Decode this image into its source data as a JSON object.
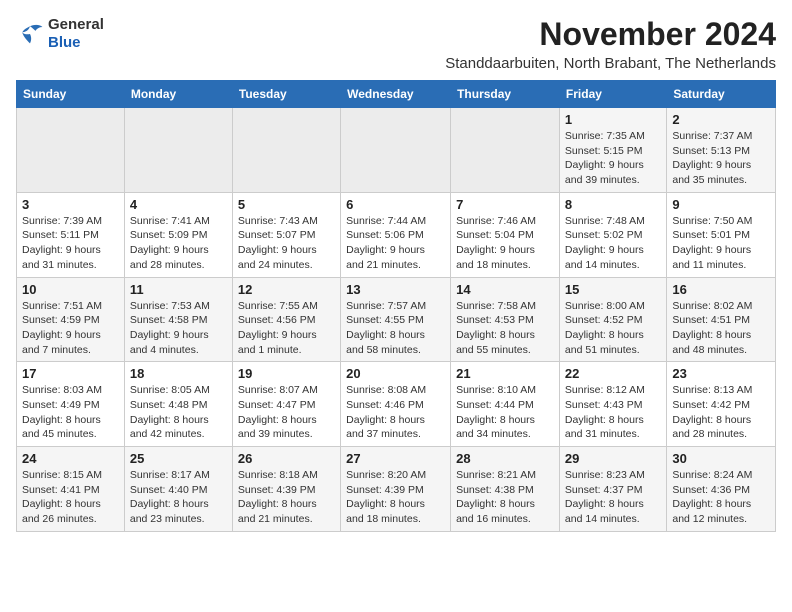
{
  "logo": {
    "text_general": "General",
    "text_blue": "Blue",
    "tagline": ""
  },
  "header": {
    "title": "November 2024",
    "subtitle": "Standdaarbuiten, North Brabant, The Netherlands"
  },
  "columns": [
    "Sunday",
    "Monday",
    "Tuesday",
    "Wednesday",
    "Thursday",
    "Friday",
    "Saturday"
  ],
  "weeks": [
    {
      "days": [
        {
          "num": "",
          "detail": ""
        },
        {
          "num": "",
          "detail": ""
        },
        {
          "num": "",
          "detail": ""
        },
        {
          "num": "",
          "detail": ""
        },
        {
          "num": "",
          "detail": ""
        },
        {
          "num": "1",
          "detail": "Sunrise: 7:35 AM\nSunset: 5:15 PM\nDaylight: 9 hours and 39 minutes."
        },
        {
          "num": "2",
          "detail": "Sunrise: 7:37 AM\nSunset: 5:13 PM\nDaylight: 9 hours and 35 minutes."
        }
      ]
    },
    {
      "days": [
        {
          "num": "3",
          "detail": "Sunrise: 7:39 AM\nSunset: 5:11 PM\nDaylight: 9 hours and 31 minutes."
        },
        {
          "num": "4",
          "detail": "Sunrise: 7:41 AM\nSunset: 5:09 PM\nDaylight: 9 hours and 28 minutes."
        },
        {
          "num": "5",
          "detail": "Sunrise: 7:43 AM\nSunset: 5:07 PM\nDaylight: 9 hours and 24 minutes."
        },
        {
          "num": "6",
          "detail": "Sunrise: 7:44 AM\nSunset: 5:06 PM\nDaylight: 9 hours and 21 minutes."
        },
        {
          "num": "7",
          "detail": "Sunrise: 7:46 AM\nSunset: 5:04 PM\nDaylight: 9 hours and 18 minutes."
        },
        {
          "num": "8",
          "detail": "Sunrise: 7:48 AM\nSunset: 5:02 PM\nDaylight: 9 hours and 14 minutes."
        },
        {
          "num": "9",
          "detail": "Sunrise: 7:50 AM\nSunset: 5:01 PM\nDaylight: 9 hours and 11 minutes."
        }
      ]
    },
    {
      "days": [
        {
          "num": "10",
          "detail": "Sunrise: 7:51 AM\nSunset: 4:59 PM\nDaylight: 9 hours and 7 minutes."
        },
        {
          "num": "11",
          "detail": "Sunrise: 7:53 AM\nSunset: 4:58 PM\nDaylight: 9 hours and 4 minutes."
        },
        {
          "num": "12",
          "detail": "Sunrise: 7:55 AM\nSunset: 4:56 PM\nDaylight: 9 hours and 1 minute."
        },
        {
          "num": "13",
          "detail": "Sunrise: 7:57 AM\nSunset: 4:55 PM\nDaylight: 8 hours and 58 minutes."
        },
        {
          "num": "14",
          "detail": "Sunrise: 7:58 AM\nSunset: 4:53 PM\nDaylight: 8 hours and 55 minutes."
        },
        {
          "num": "15",
          "detail": "Sunrise: 8:00 AM\nSunset: 4:52 PM\nDaylight: 8 hours and 51 minutes."
        },
        {
          "num": "16",
          "detail": "Sunrise: 8:02 AM\nSunset: 4:51 PM\nDaylight: 8 hours and 48 minutes."
        }
      ]
    },
    {
      "days": [
        {
          "num": "17",
          "detail": "Sunrise: 8:03 AM\nSunset: 4:49 PM\nDaylight: 8 hours and 45 minutes."
        },
        {
          "num": "18",
          "detail": "Sunrise: 8:05 AM\nSunset: 4:48 PM\nDaylight: 8 hours and 42 minutes."
        },
        {
          "num": "19",
          "detail": "Sunrise: 8:07 AM\nSunset: 4:47 PM\nDaylight: 8 hours and 39 minutes."
        },
        {
          "num": "20",
          "detail": "Sunrise: 8:08 AM\nSunset: 4:46 PM\nDaylight: 8 hours and 37 minutes."
        },
        {
          "num": "21",
          "detail": "Sunrise: 8:10 AM\nSunset: 4:44 PM\nDaylight: 8 hours and 34 minutes."
        },
        {
          "num": "22",
          "detail": "Sunrise: 8:12 AM\nSunset: 4:43 PM\nDaylight: 8 hours and 31 minutes."
        },
        {
          "num": "23",
          "detail": "Sunrise: 8:13 AM\nSunset: 4:42 PM\nDaylight: 8 hours and 28 minutes."
        }
      ]
    },
    {
      "days": [
        {
          "num": "24",
          "detail": "Sunrise: 8:15 AM\nSunset: 4:41 PM\nDaylight: 8 hours and 26 minutes."
        },
        {
          "num": "25",
          "detail": "Sunrise: 8:17 AM\nSunset: 4:40 PM\nDaylight: 8 hours and 23 minutes."
        },
        {
          "num": "26",
          "detail": "Sunrise: 8:18 AM\nSunset: 4:39 PM\nDaylight: 8 hours and 21 minutes."
        },
        {
          "num": "27",
          "detail": "Sunrise: 8:20 AM\nSunset: 4:39 PM\nDaylight: 8 hours and 18 minutes."
        },
        {
          "num": "28",
          "detail": "Sunrise: 8:21 AM\nSunset: 4:38 PM\nDaylight: 8 hours and 16 minutes."
        },
        {
          "num": "29",
          "detail": "Sunrise: 8:23 AM\nSunset: 4:37 PM\nDaylight: 8 hours and 14 minutes."
        },
        {
          "num": "30",
          "detail": "Sunrise: 8:24 AM\nSunset: 4:36 PM\nDaylight: 8 hours and 12 minutes."
        }
      ]
    }
  ]
}
